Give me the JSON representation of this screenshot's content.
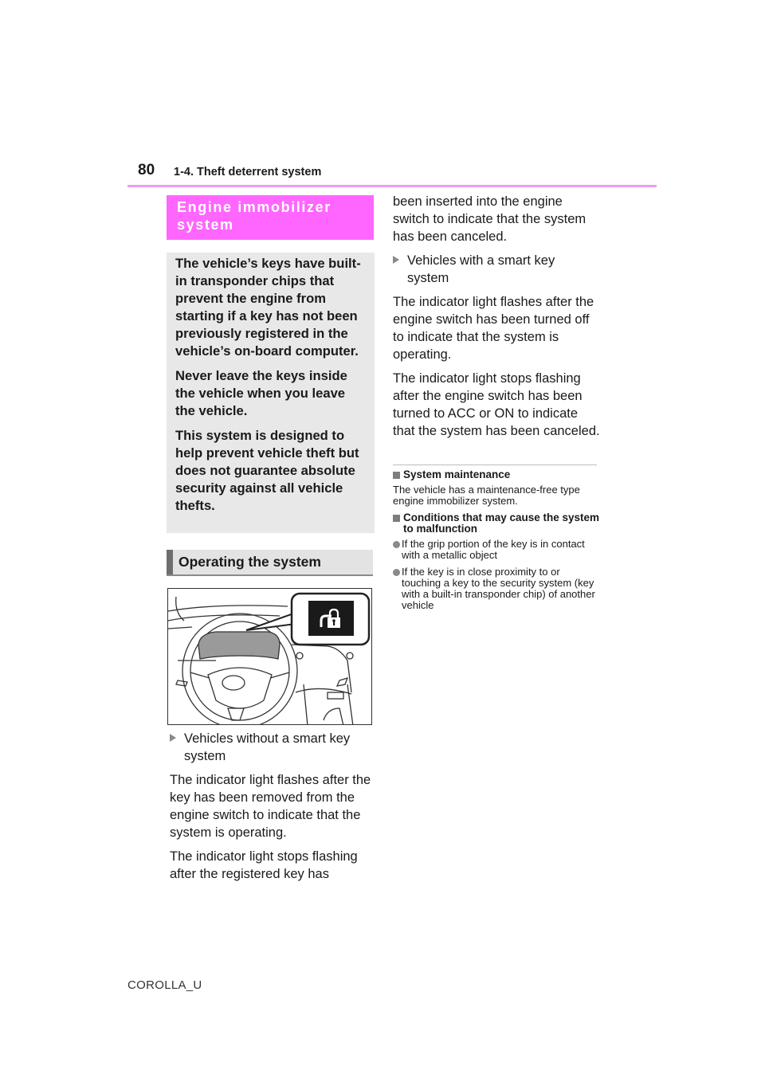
{
  "header": {
    "page_number": "80",
    "section": "1-4. Theft deterrent system"
  },
  "engine_immobilizer": {
    "heading": "Engine immobilizer system",
    "intro_paragraphs": [
      "The vehicle’s keys have built-in transponder chips that prevent the engine from starting if a key has not been previously registered in the vehicle’s on-board computer.",
      "Never leave the keys inside the vehicle when you leave the vehicle.",
      "This system is designed to help prevent vehicle theft but does not guarantee absolute security against all vehicle thefts."
    ]
  },
  "operating": {
    "heading": "Operating the system",
    "illustration": {
      "description": "Instrument panel with steering wheel; callout shows security indicator light",
      "icon": "security-indicator-icon"
    },
    "without_smart_key": {
      "label": "Vehicles without a smart key system",
      "paragraphs": [
        "The indicator light flashes after the key has been removed from the engine switch to indicate that the system is operating.",
        "The indicator light stops flashing after the registered key has been inserted into the engine switch to indicate that the system has been canceled."
      ]
    },
    "with_smart_key": {
      "label": "Vehicles with a smart key system",
      "paragraphs": [
        "The indicator light flashes after the engine switch has been turned off to indicate that the system is operating.",
        "The indicator light stops flashing after the engine switch has been turned to ACC or ON to indicate that the system has been canceled."
      ]
    }
  },
  "notes": {
    "maintenance": {
      "heading": "System maintenance",
      "text": "The vehicle has a maintenance-free type engine immobilizer system."
    },
    "malfunction": {
      "heading": "Conditions that may cause the system to malfunction",
      "bullets": [
        "If the grip portion of the key is in contact with a metallic object",
        "If the key is in close proximity to or touching a key to the security system (key with a built-in transponder chip) of another vehicle"
      ]
    }
  },
  "footer": {
    "model": "COROLLA_U"
  },
  "colors": {
    "accent_pink": "#ff66ff",
    "header_rule": "#f29af0",
    "box_gray": "#e8e8e8"
  }
}
